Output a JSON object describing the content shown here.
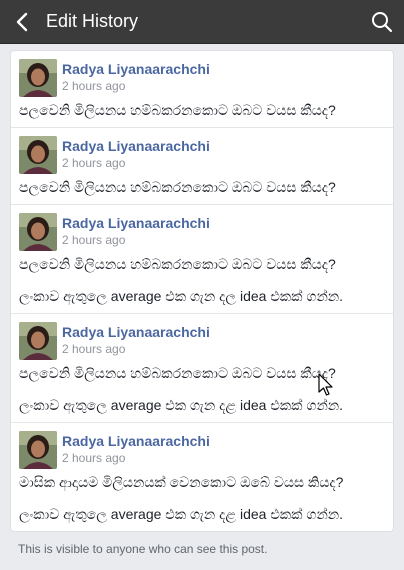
{
  "header": {
    "title": "Edit History",
    "back_icon": "arrow-left-icon",
    "search_icon": "search-icon"
  },
  "entries": [
    {
      "author": "Radya Liyanaarachchi",
      "time": "2 hours ago",
      "lines": [
        "පලවෙනි මිලියනය හම්බකරනකොට ඔබට වයස කීයද?",
        ""
      ]
    },
    {
      "author": "Radya Liyanaarachchi",
      "time": "2 hours ago",
      "lines": [
        "පලවෙනි මිලියනය හම්බකරනකොට ඔබට වයස කීයද?",
        ""
      ]
    },
    {
      "author": "Radya Liyanaarachchi",
      "time": "2 hours ago",
      "lines": [
        "පලවෙනි මිලියනය හම්බකරනකොට ඔබට වයස කීයද?",
        "ලංකාව ඇතුලෙ average එක ගැන දල idea එකක් ගන්න."
      ]
    },
    {
      "author": "Radya Liyanaarachchi",
      "time": "2 hours ago",
      "lines": [
        "පලවෙනි මිලියනය හම්බකරනකොට ඔබට වයස කීයද?",
        "ලංකාව ඇතුලෙ average එක ගැන දළ idea එකක් ගන්න."
      ]
    },
    {
      "author": "Radya Liyanaarachchi",
      "time": "2 hours ago",
      "lines": [
        "මාසික ආදායම මිලියනයක් වෙනකොට ඔබේ වයස කියද?",
        "ලංකාව ඇතුලෙ average එක ගැන දළ idea එකක් ගන්න."
      ]
    }
  ],
  "footer": {
    "note": "This is visible to anyone who can see this post."
  },
  "colors": {
    "topbar": "#3b3b3b",
    "author": "#4b67a1",
    "background": "#e9ebee"
  }
}
